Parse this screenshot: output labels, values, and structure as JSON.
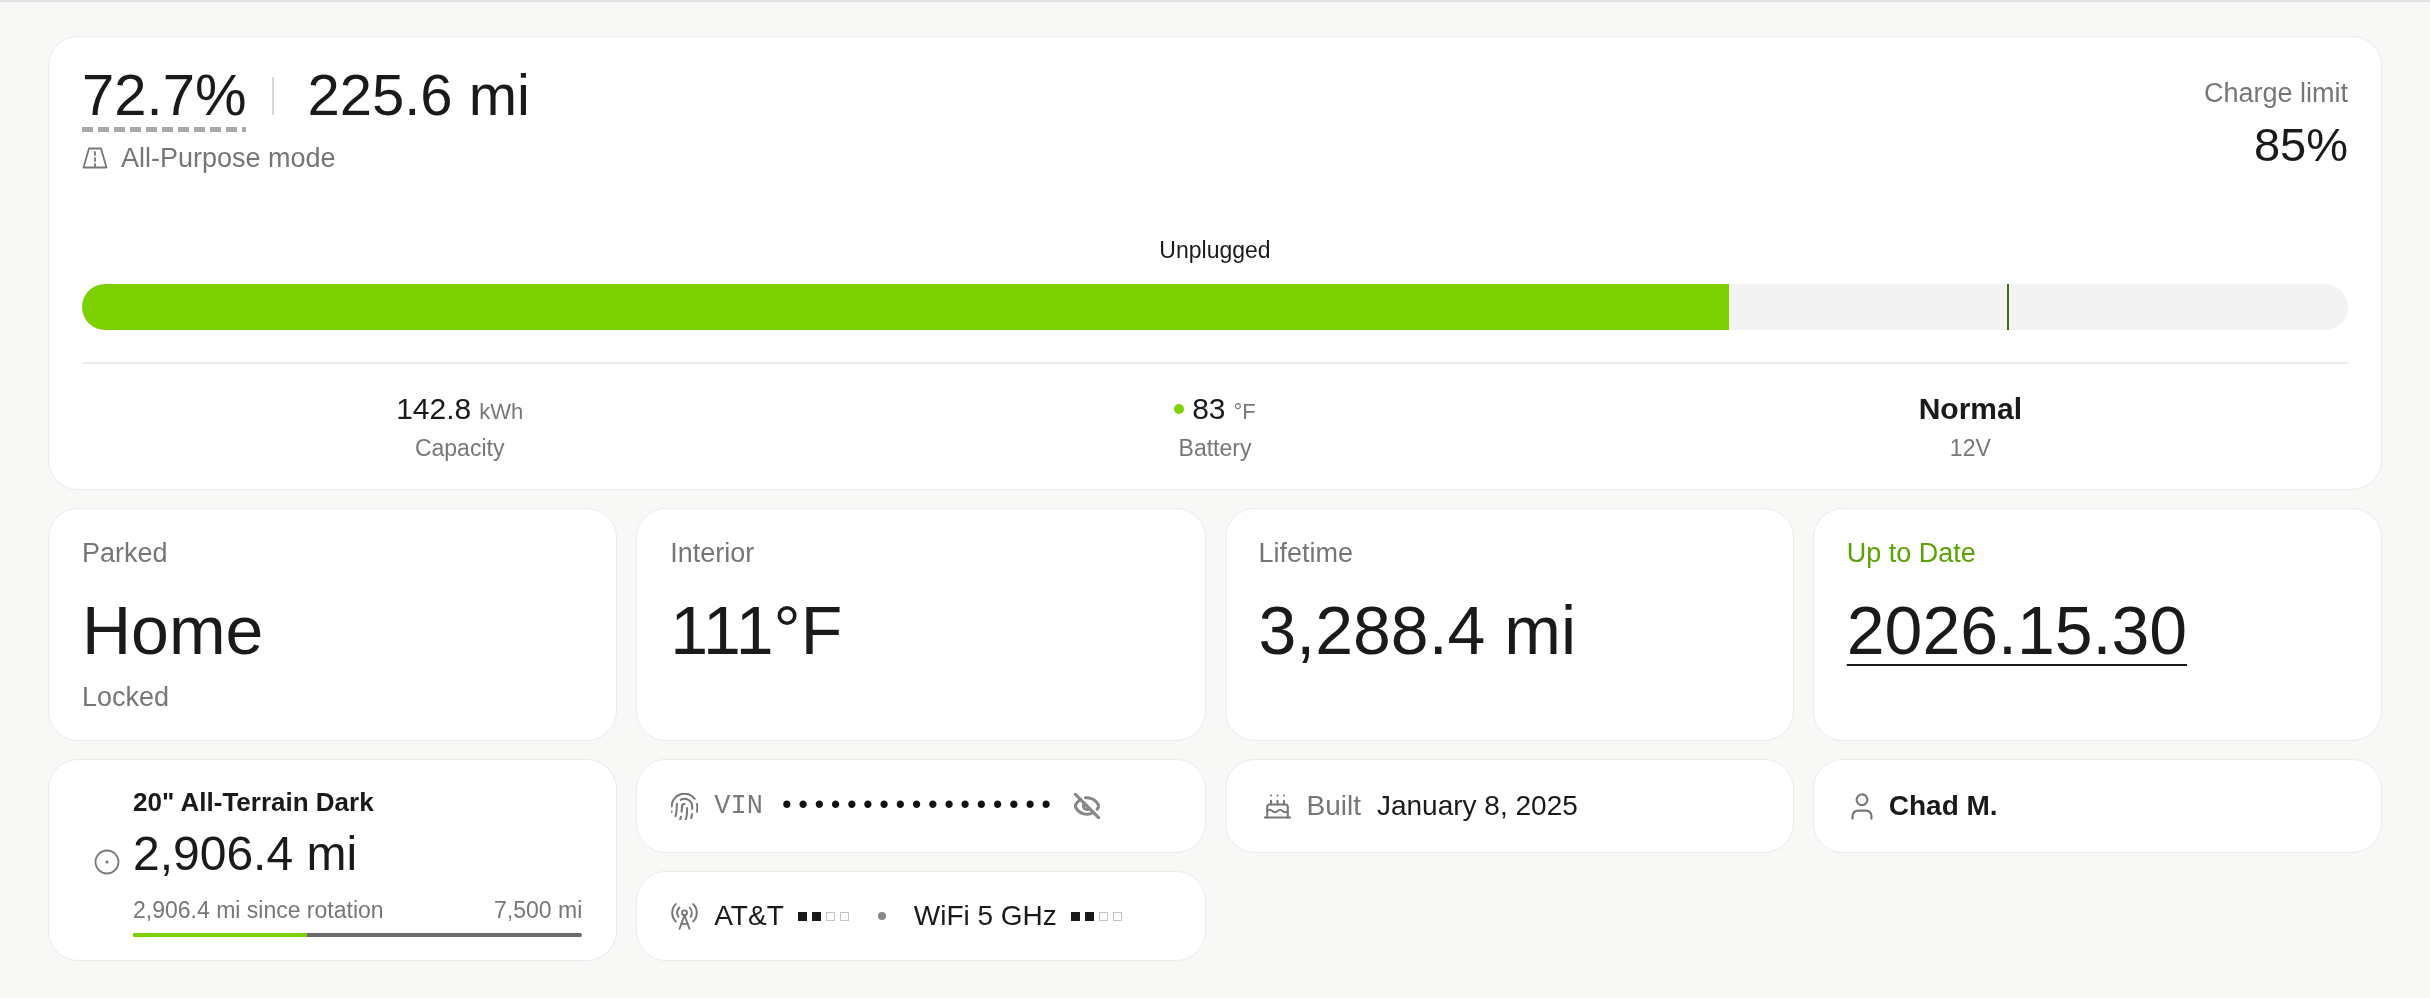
{
  "summary": {
    "charge": "72.7%",
    "range": "225.6 mi",
    "mode": "All-Purpose mode",
    "charge_limit": {
      "label": "Charge limit",
      "value": "85%",
      "level": 0.85
    },
    "status": "Unplugged",
    "level": 0.727,
    "stats": [
      {
        "kind": "measure",
        "value": "142.8",
        "unit": "kWh",
        "label": "Capacity"
      },
      {
        "kind": "measure",
        "value": "83",
        "unit": "°F",
        "label": "Battery",
        "color": "#7ed100"
      },
      {
        "kind": "status",
        "value": "Normal",
        "label": "12V"
      }
    ]
  },
  "cards": [
    {
      "kind": "stat",
      "label": "Parked",
      "value": "Home",
      "note": "Locked"
    },
    {
      "kind": "stat",
      "label": "Interior",
      "value": "111°F"
    },
    {
      "kind": "stat",
      "label": "Lifetime",
      "value": "3,288.4 mi"
    },
    {
      "kind": "update",
      "label": "Up to Date",
      "value": "2026.15.30"
    }
  ],
  "tire": {
    "name": "20\" All-Terrain Dark",
    "mileage": "2,906.4 mi",
    "since_rotation": "2,906.4 mi since rotation",
    "interval": "7,500 mi",
    "level": 0.3875
  },
  "vin": {
    "label": "VIN",
    "value": "•••••••••••••••••",
    "revealed": false
  },
  "built": {
    "label": "Built",
    "value": "January 8, 2025"
  },
  "owner": {
    "name": "Chad M."
  },
  "connectivity": {
    "networks": [
      {
        "name": "AT&T"
      },
      {
        "name": "WiFi 5 GHz"
      }
    ]
  }
}
